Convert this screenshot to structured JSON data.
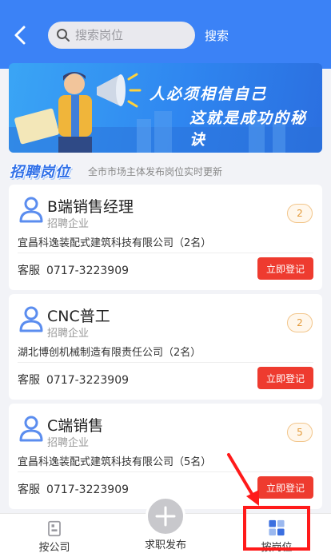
{
  "header": {
    "search_placeholder": "搜索岗位",
    "search_button": "搜索"
  },
  "banner": {
    "line1": "人必须相信自己",
    "line2": "这就是成功的秘诀"
  },
  "section": {
    "title": "招聘岗位",
    "subtitle": "全市市场主体发布岗位实时更新"
  },
  "jobs": [
    {
      "title": "B端销售经理",
      "type": "招聘企业",
      "count": "2",
      "company": "宜昌科逸装配式建筑科技有限公司（2名）",
      "contact_label": "客服",
      "phone": "0717-3223909",
      "action": "立即登记"
    },
    {
      "title": "CNC普工",
      "type": "招聘企业",
      "count": "2",
      "company": "湖北博创机械制造有限责任公司（2名）",
      "contact_label": "客服",
      "phone": "0717-3223909",
      "action": "立即登记"
    },
    {
      "title": "C端销售",
      "type": "招聘企业",
      "count": "5",
      "company": "宜昌科逸装配式建筑科技有限公司（5名）",
      "contact_label": "客服",
      "phone": "0717-3223909",
      "action": "立即登记"
    }
  ],
  "nav": {
    "company": "按公司",
    "post": "求职发布",
    "position": "按岗位"
  },
  "colors": {
    "header_blue": "#3b82f6",
    "accent_red": "#ee3b2f",
    "badge_orange": "#e39a3a",
    "highlight_red": "#ff1a1a"
  },
  "icons": {
    "back": "chevron-left-icon",
    "search": "search-icon",
    "avatar": "user-icon",
    "company": "building-icon",
    "post": "plus-icon",
    "position": "grid-icon"
  }
}
